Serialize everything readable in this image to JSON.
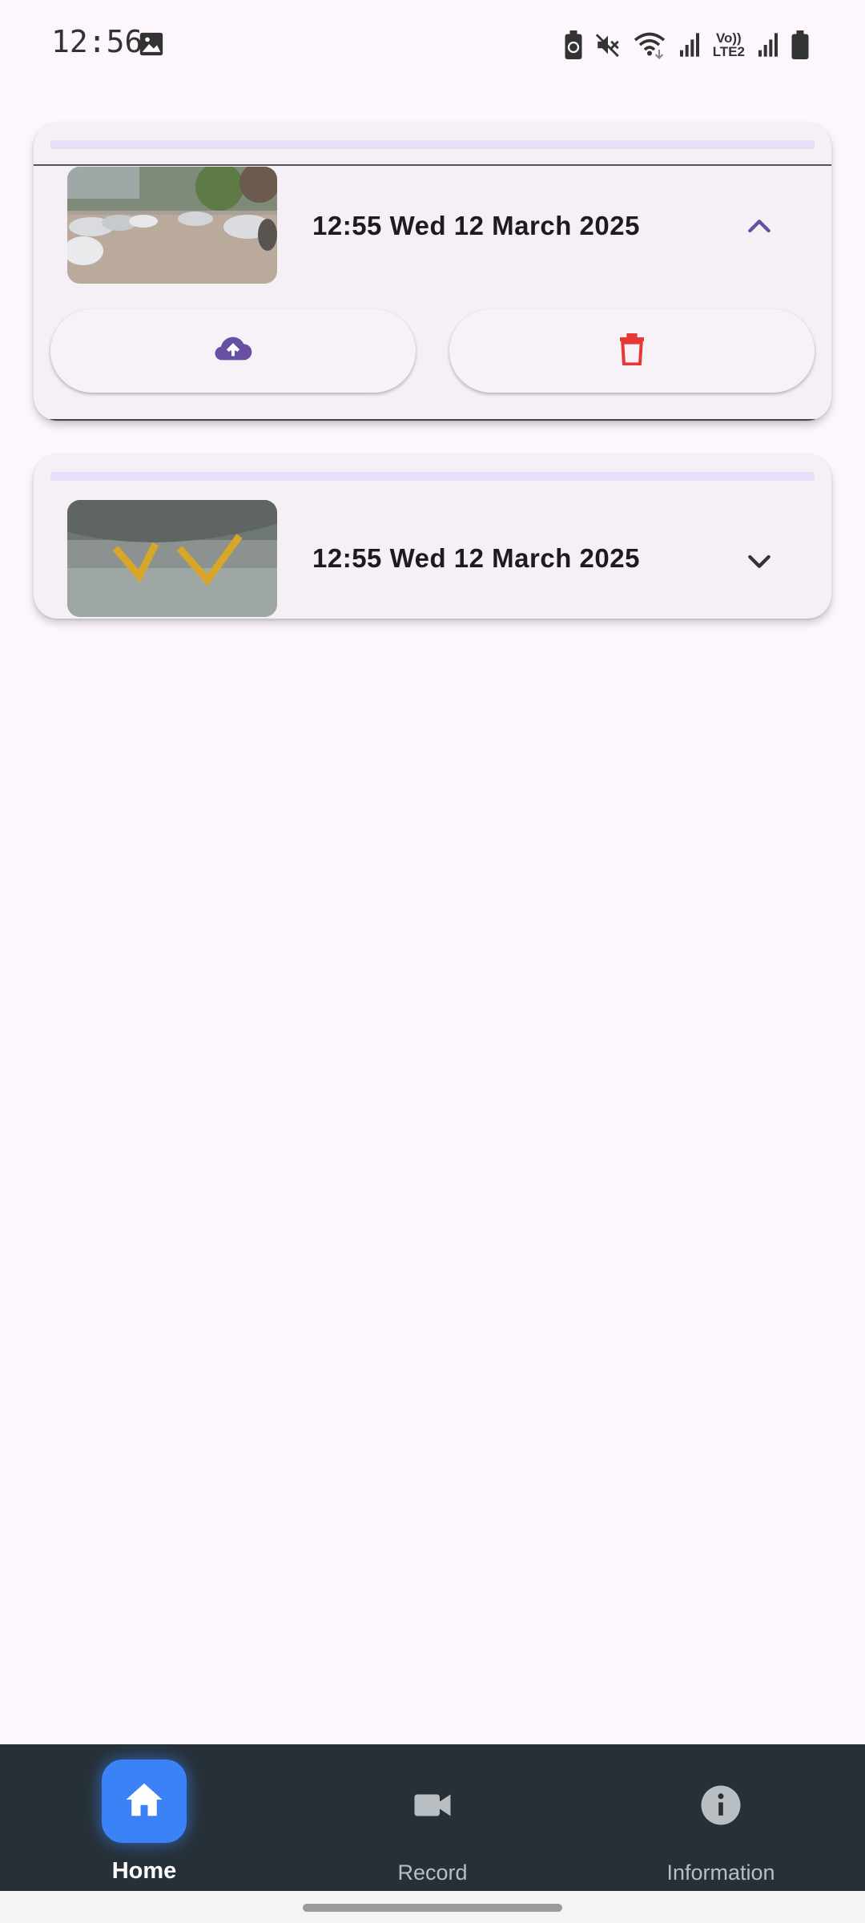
{
  "status_bar": {
    "time": "12:56",
    "icons": [
      "image-icon",
      "battery-saver-icon",
      "mute-icon",
      "wifi-icon",
      "signal-icon",
      "volte-lte2-icon",
      "signal-2-icon",
      "battery-icon"
    ],
    "volte_text": "Vo))",
    "lte_text": "LTE2"
  },
  "recordings": [
    {
      "datetime": "12:55 Wed 12 March 2025",
      "expanded": true,
      "thumbnail": "parking-lot-photo",
      "chevron_icon": "chevron-up-icon",
      "actions": [
        {
          "icon": "cloud-upload-icon",
          "color": "#6750a4"
        },
        {
          "icon": "delete-icon",
          "color": "#e53935"
        }
      ]
    },
    {
      "datetime": "12:55 Wed 12 March 2025",
      "expanded": false,
      "thumbnail": "road-markings-photo",
      "chevron_icon": "chevron-down-icon"
    }
  ],
  "bottom_nav": {
    "items": [
      {
        "label": "Home",
        "icon": "home-icon",
        "active": true
      },
      {
        "label": "Record",
        "icon": "videocam-icon",
        "active": false
      },
      {
        "label": "Information",
        "icon": "info-icon",
        "active": false
      }
    ]
  },
  "colors": {
    "background": "#fdf7fd",
    "card": "#f5f0f6",
    "accent": "#6750a4",
    "delete": "#e53935",
    "nav_background": "#263036",
    "nav_active": "#3b82f6"
  }
}
